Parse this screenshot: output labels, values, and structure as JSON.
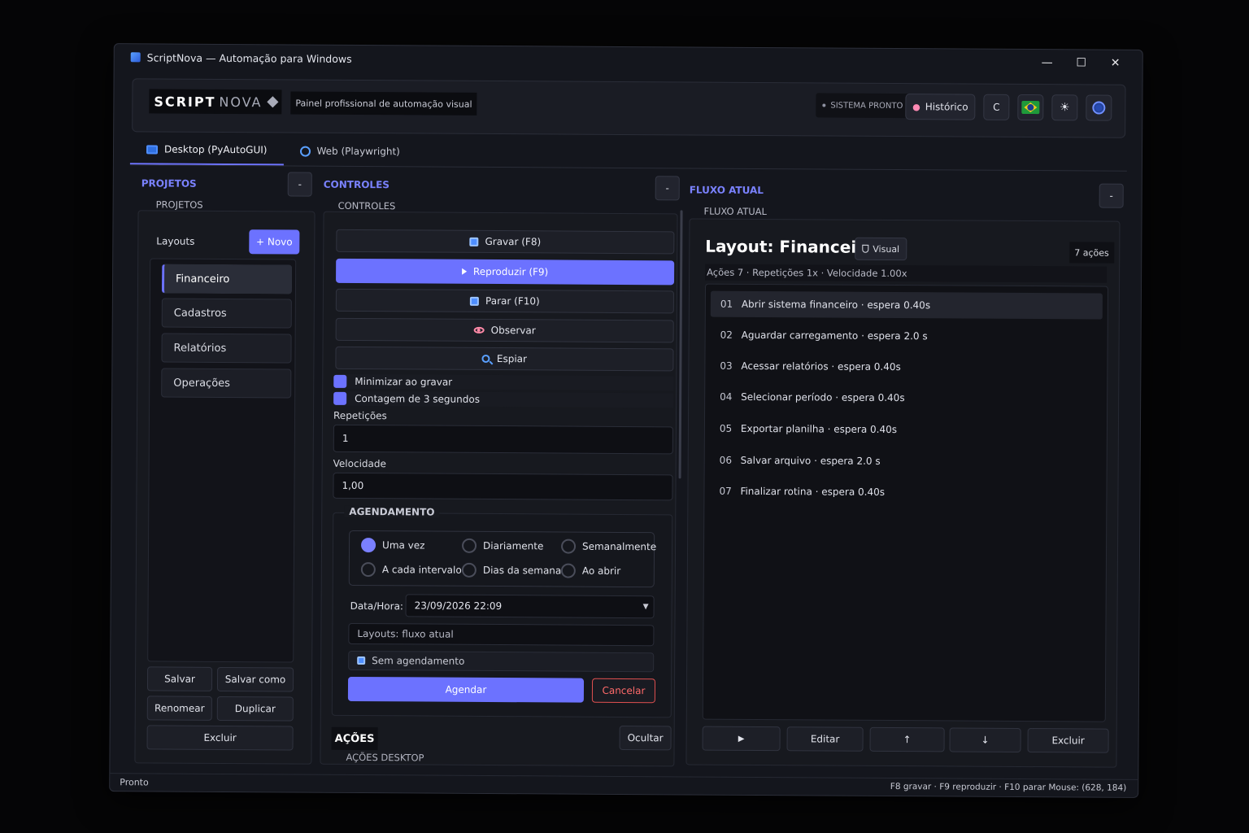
{
  "window": {
    "title": "ScriptNova — Automação para Windows",
    "controls": {
      "minimize": "—",
      "maximize": "☐",
      "close": "✕"
    }
  },
  "header": {
    "logo_script": "SCRIPT",
    "logo_nova": "NOVA",
    "subtitle": "Painel profissional de automação visual",
    "status": "SISTEMA PRONTO",
    "history_label": "Histórico",
    "c_label": "C",
    "icons": [
      "history-icon",
      "flag-brazil-icon",
      "sun-icon",
      "globe-icon"
    ]
  },
  "tabs": [
    {
      "label": "Desktop (PyAutoGUI)",
      "active": true,
      "icon": "monitor-icon"
    },
    {
      "label": "Web (Playwright)",
      "active": false,
      "icon": "globe-icon"
    }
  ],
  "projects": {
    "section_title": "PROJETOS",
    "group_label": "PROJETOS",
    "collapse_label": "-",
    "layouts_label": "Layouts",
    "new_label": "+ Novo",
    "items": [
      {
        "label": "Financeiro",
        "active": true
      },
      {
        "label": "Cadastros",
        "active": false
      },
      {
        "label": "Relatórios",
        "active": false
      },
      {
        "label": "Operações",
        "active": false
      }
    ],
    "buttons": {
      "save": "Salvar",
      "save_as": "Salvar como",
      "rename": "Renomear",
      "duplicate": "Duplicar",
      "delete": "Excluir"
    }
  },
  "controls": {
    "section_title": "CONTROLES",
    "group_label": "CONTROLES",
    "collapse_label": "-",
    "record": "Gravar  (F8)",
    "play": "Reproduzir  (F9)",
    "stop": "Parar  (F10)",
    "observe": "Observar",
    "spy": "Espiar",
    "minimize_on_record": "Minimizar ao gravar",
    "countdown": "Contagem de 3 segundos",
    "repetitions_label": "Repetições",
    "repetitions_value": "1",
    "speed_label": "Velocidade",
    "speed_value": "1,00"
  },
  "scheduling": {
    "title": "AGENDAMENTO",
    "options": [
      {
        "label": "Uma vez",
        "selected": true
      },
      {
        "label": "Diariamente",
        "selected": false
      },
      {
        "label": "Semanalmente",
        "selected": false
      },
      {
        "label": "A cada intervalo",
        "selected": false
      },
      {
        "label": "Dias da semana",
        "selected": false
      },
      {
        "label": "Ao abrir",
        "selected": false
      }
    ],
    "datetime_label": "Data/Hora:",
    "datetime_value": "23/09/2026   22:09",
    "layouts_field": "Layouts: fluxo atual",
    "no_schedule": "Sem agendamento",
    "schedule_button": "Agendar",
    "cancel_button": "Cancelar"
  },
  "actions": {
    "title": "AÇÕES",
    "hide_button": "Ocultar",
    "subtitle": "AÇÕES DESKTOP"
  },
  "flow": {
    "section_title": "FLUXO ATUAL",
    "group_label": "FLUXO ATUAL",
    "collapse_label": "-",
    "layout_title": "Layout: Financeiro",
    "visual_badge": "Visual",
    "count_badge": "7 ações",
    "meta": "Ações 7  ·  Repetições 1x  ·  Velocidade 1.00x",
    "steps": [
      {
        "num": "01",
        "text": "Abrir sistema financeiro  ·  espera 0.40s",
        "active": true
      },
      {
        "num": "02",
        "text": "Aguardar carregamento  ·  espera 2.0 s",
        "active": false
      },
      {
        "num": "03",
        "text": "Acessar relatórios  ·  espera 0.40s",
        "active": false
      },
      {
        "num": "04",
        "text": "Selecionar período  ·  espera 0.40s",
        "active": false
      },
      {
        "num": "05",
        "text": "Exportar planilha  ·  espera 0.40s",
        "active": false
      },
      {
        "num": "06",
        "text": "Salvar arquivo  ·  espera 2.0 s",
        "active": false
      },
      {
        "num": "07",
        "text": "Finalizar rotina  ·  espera 0.40s",
        "active": false
      }
    ],
    "buttons": {
      "play": "▶",
      "edit": "Editar",
      "up": "↑",
      "down": "↓",
      "delete": "Excluir"
    }
  },
  "statusbar": {
    "left": "Pronto",
    "right": "F8 gravar · F9 reproduzir · F10 parar  Mouse: (628, 184)"
  },
  "colors": {
    "accent": "#6c72ff",
    "danger": "#e05050",
    "background": "#14161d"
  }
}
